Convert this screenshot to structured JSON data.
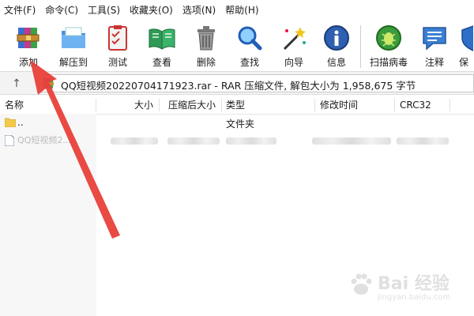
{
  "menu": [
    "文件(F)",
    "命令(C)",
    "工具(S)",
    "收藏夹(O)",
    "选项(N)",
    "帮助(H)"
  ],
  "toolbar": [
    {
      "label": "添加",
      "icon": "add-archive-icon"
    },
    {
      "label": "解压到",
      "icon": "extract-folder-icon"
    },
    {
      "label": "测试",
      "icon": "test-clipboard-icon"
    },
    {
      "label": "查看",
      "icon": "view-book-icon"
    },
    {
      "label": "删除",
      "icon": "trash-icon"
    },
    {
      "label": "查找",
      "icon": "find-magnifier-icon"
    },
    {
      "label": "向导",
      "icon": "wizard-wand-icon"
    },
    {
      "label": "信息",
      "icon": "info-icon"
    },
    {
      "label": "扫描病毒",
      "icon": "virus-scan-icon"
    },
    {
      "label": "注释",
      "icon": "comment-icon"
    },
    {
      "label": "保",
      "icon": "protect-shield-icon"
    }
  ],
  "address": {
    "up_glyph": "↑",
    "path": "QQ短视频20220704171923.rar - RAR 压缩文件, 解包大小为 1,958,675 字节"
  },
  "columns": [
    "名称",
    "大小",
    "压缩后大小",
    "类型",
    "修改时间",
    "CRC32"
  ],
  "rows": [
    {
      "name": "..",
      "type": "文件夹"
    },
    {
      "name": "QQ短视频2...",
      "type": ""
    }
  ],
  "watermark": {
    "brand": "Bai 经验",
    "url": "jingyan.baidu.com"
  },
  "colors": {
    "annotation_arrow": "#e8403a",
    "address_bg": "#f3f3f3"
  }
}
